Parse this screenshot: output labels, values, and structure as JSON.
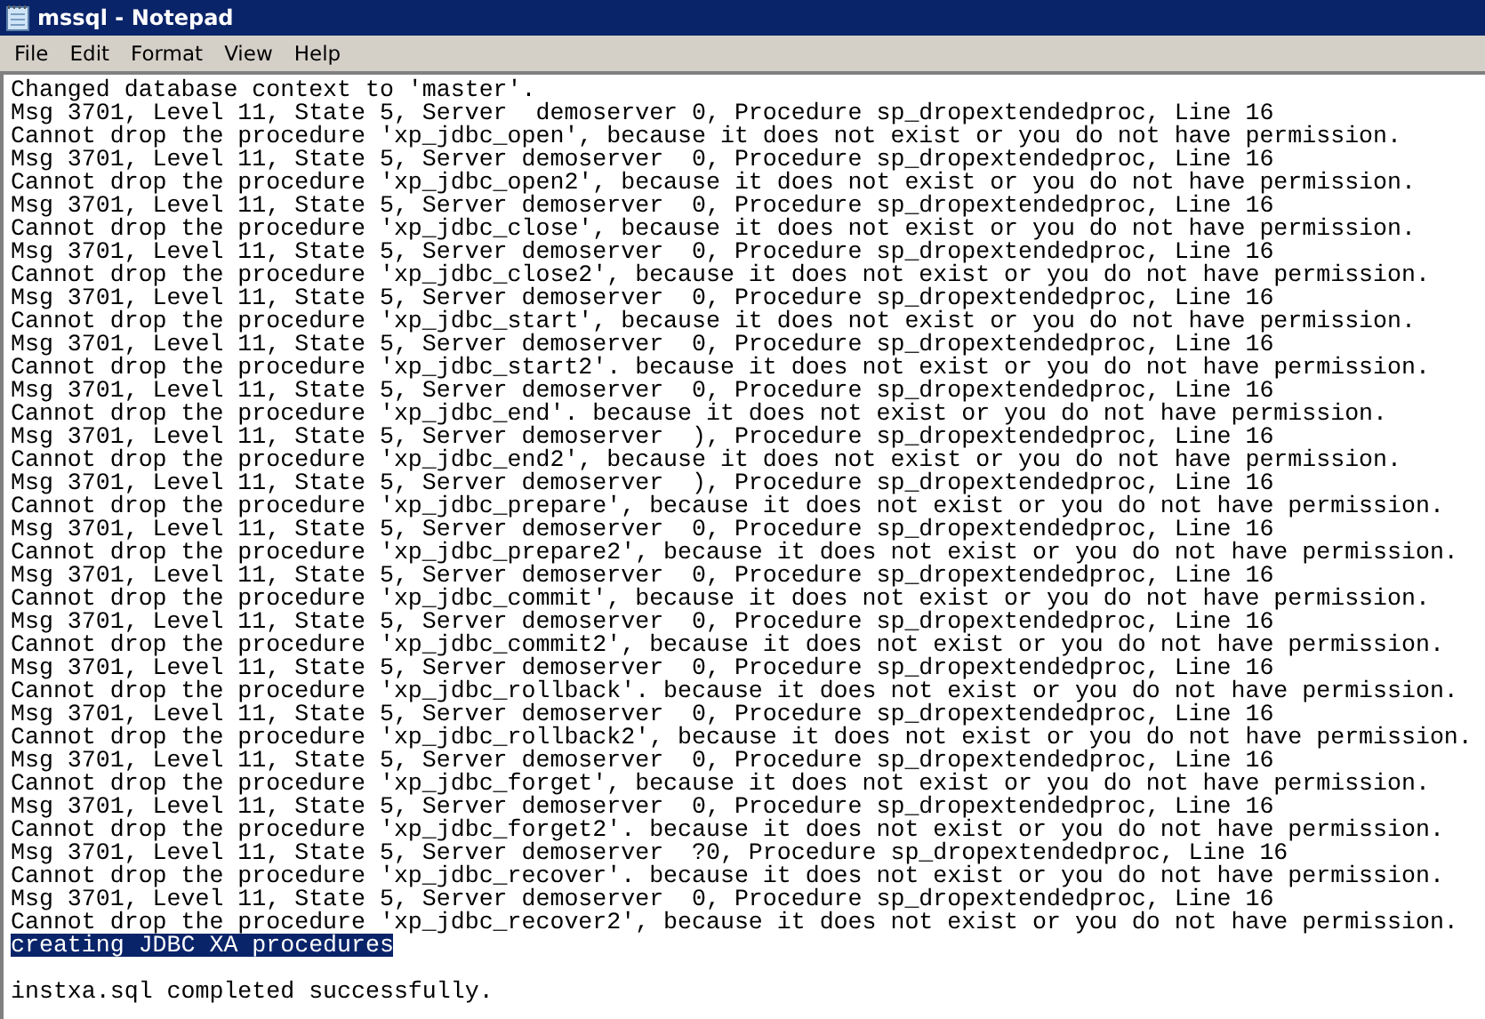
{
  "window": {
    "title": "mssql - Notepad"
  },
  "menu": [
    "File",
    "Edit",
    "Format",
    "View",
    "Help"
  ],
  "lines": [
    {
      "text": "Changed database context to 'master'.",
      "selected": false
    },
    {
      "text": "Msg 3701, Level 11, State 5, Server  demoserver 0, Procedure sp_dropextendedproc, Line 16",
      "selected": false
    },
    {
      "text": "Cannot drop the procedure 'xp_jdbc_open', because it does not exist or you do not have permission.",
      "selected": false
    },
    {
      "text": "Msg 3701, Level 11, State 5, Server demoserver  0, Procedure sp_dropextendedproc, Line 16",
      "selected": false
    },
    {
      "text": "Cannot drop the procedure 'xp_jdbc_open2', because it does not exist or you do not have permission.",
      "selected": false
    },
    {
      "text": "Msg 3701, Level 11, State 5, Server demoserver  0, Procedure sp_dropextendedproc, Line 16",
      "selected": false
    },
    {
      "text": "Cannot drop the procedure 'xp_jdbc_close', because it does not exist or you do not have permission.",
      "selected": false
    },
    {
      "text": "Msg 3701, Level 11, State 5, Server demoserver  0, Procedure sp_dropextendedproc, Line 16",
      "selected": false
    },
    {
      "text": "Cannot drop the procedure 'xp_jdbc_close2', because it does not exist or you do not have permission.",
      "selected": false
    },
    {
      "text": "Msg 3701, Level 11, State 5, Server demoserver  0, Procedure sp_dropextendedproc, Line 16",
      "selected": false
    },
    {
      "text": "Cannot drop the procedure 'xp_jdbc_start', because it does not exist or you do not have permission.",
      "selected": false
    },
    {
      "text": "Msg 3701, Level 11, State 5, Server demoserver  0, Procedure sp_dropextendedproc, Line 16",
      "selected": false
    },
    {
      "text": "Cannot drop the procedure 'xp_jdbc_start2'. because it does not exist or you do not have permission.",
      "selected": false
    },
    {
      "text": "Msg 3701, Level 11, State 5, Server demoserver  0, Procedure sp_dropextendedproc, Line 16",
      "selected": false
    },
    {
      "text": "Cannot drop the procedure 'xp_jdbc_end'. because it does not exist or you do not have permission.",
      "selected": false
    },
    {
      "text": "Msg 3701, Level 11, State 5, Server demoserver  ), Procedure sp_dropextendedproc, Line 16",
      "selected": false
    },
    {
      "text": "Cannot drop the procedure 'xp_jdbc_end2', because it does not exist or you do not have permission.",
      "selected": false
    },
    {
      "text": "Msg 3701, Level 11, State 5, Server demoserver  ), Procedure sp_dropextendedproc, Line 16",
      "selected": false
    },
    {
      "text": "Cannot drop the procedure 'xp_jdbc_prepare', because it does not exist or you do not have permission.",
      "selected": false
    },
    {
      "text": "Msg 3701, Level 11, State 5, Server demoserver  0, Procedure sp_dropextendedproc, Line 16",
      "selected": false
    },
    {
      "text": "Cannot drop the procedure 'xp_jdbc_prepare2', because it does not exist or you do not have permission.",
      "selected": false
    },
    {
      "text": "Msg 3701, Level 11, State 5, Server demoserver  0, Procedure sp_dropextendedproc, Line 16",
      "selected": false
    },
    {
      "text": "Cannot drop the procedure 'xp_jdbc_commit', because it does not exist or you do not have permission.",
      "selected": false
    },
    {
      "text": "Msg 3701, Level 11, State 5, Server demoserver  0, Procedure sp_dropextendedproc, Line 16",
      "selected": false
    },
    {
      "text": "Cannot drop the procedure 'xp_jdbc_commit2', because it does not exist or you do not have permission.",
      "selected": false
    },
    {
      "text": "Msg 3701, Level 11, State 5, Server demoserver  0, Procedure sp_dropextendedproc, Line 16",
      "selected": false
    },
    {
      "text": "Cannot drop the procedure 'xp_jdbc_rollback'. because it does not exist or you do not have permission.",
      "selected": false
    },
    {
      "text": "Msg 3701, Level 11, State 5, Server demoserver  0, Procedure sp_dropextendedproc, Line 16",
      "selected": false
    },
    {
      "text": "Cannot drop the procedure 'xp_jdbc_rollback2', because it does not exist or you do not have permission.",
      "selected": false
    },
    {
      "text": "Msg 3701, Level 11, State 5, Server demoserver  0, Procedure sp_dropextendedproc, Line 16",
      "selected": false
    },
    {
      "text": "Cannot drop the procedure 'xp_jdbc_forget', because it does not exist or you do not have permission.",
      "selected": false
    },
    {
      "text": "Msg 3701, Level 11, State 5, Server demoserver  0, Procedure sp_dropextendedproc, Line 16",
      "selected": false
    },
    {
      "text": "Cannot drop the procedure 'xp_jdbc_forget2'. because it does not exist or you do not have permission.",
      "selected": false
    },
    {
      "text": "Msg 3701, Level 11, State 5, Server demoserver  ?0, Procedure sp_dropextendedproc, Line 16",
      "selected": false
    },
    {
      "text": "Cannot drop the procedure 'xp_jdbc_recover'. because it does not exist or you do not have permission.",
      "selected": false
    },
    {
      "text": "Msg 3701, Level 11, State 5, Server demoserver  0, Procedure sp_dropextendedproc, Line 16",
      "selected": false
    },
    {
      "text": "Cannot drop the procedure 'xp_jdbc_recover2', because it does not exist or you do not have permission.",
      "selected": false
    },
    {
      "text": "creating JDBC XA procedures",
      "selected": true
    }
  ],
  "result": "instxa.sql completed successfully."
}
